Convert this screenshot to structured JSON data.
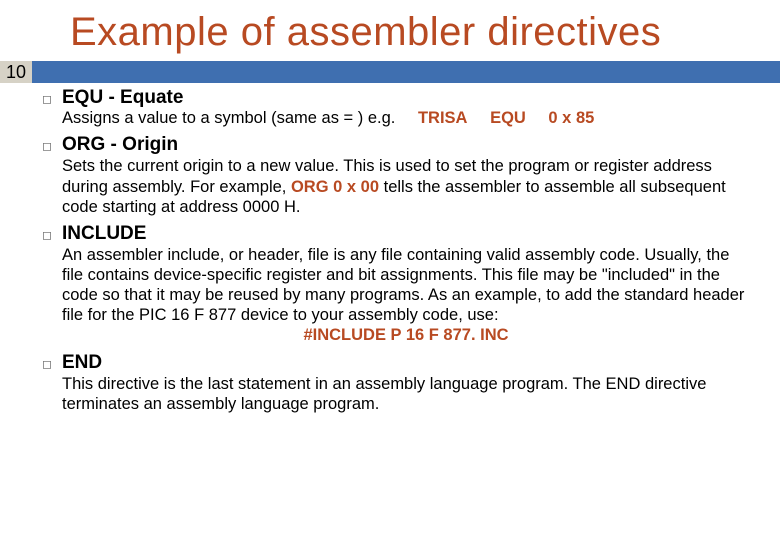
{
  "page_number": "10",
  "title": "Example of assembler directives",
  "items": [
    {
      "heading": "EQU - Equate",
      "equ_prefix": "Assigns a value to a symbol (same as = )  e.g.",
      "equ_trisa": "TRISA",
      "equ_equ": "EQU",
      "equ_val": "0 x 85"
    },
    {
      "heading": "ORG - Origin",
      "body_pre": "Sets the current origin to a new value. This is used to set the program or register address during assembly. For example, ",
      "body_org": "ORG  0 x 00",
      "body_post": "  tells the assembler to assemble all subsequent code starting at address 0000 H."
    },
    {
      "heading": "INCLUDE",
      "body": "An assembler include, or header, file is any file containing valid assembly code. Usually, the file contains device-specific register and bit assignments. This file may be \"included\" in the code so that it may be reused by many programs. As an example, to add the standard header file for the PIC 16 F 877 device to your assembly code, use:",
      "include_code": "#INCLUDE  P 16 F 877. INC"
    },
    {
      "heading": "END",
      "body": "This directive is the last statement in an assembly language program. The END directive terminates an assembly language program."
    }
  ]
}
